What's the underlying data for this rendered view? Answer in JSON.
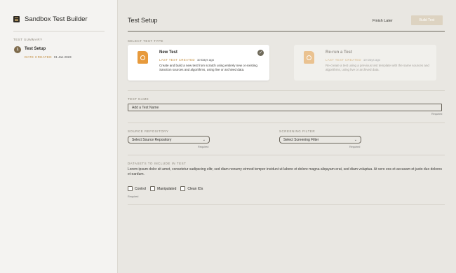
{
  "app": {
    "title": "Sandbox Test Builder",
    "logo_icon": "grid-logo-icon"
  },
  "sidebar": {
    "section_label": "TEST SUMMARY",
    "step": {
      "number": "1",
      "title": "Test Setup",
      "date_label": "DATE CREATED",
      "date_value": "01 Jan 2023"
    }
  },
  "header": {
    "title": "Test Setup",
    "finish_later": "Finish Later",
    "build_test": "Build Test"
  },
  "select_type": {
    "label": "SELECT TEST TYPE",
    "new_test": {
      "title": "New Test",
      "meta_label": "LAST TEST CREATED",
      "meta_value": "10 Days ago",
      "description": "Create and build a new test from scratch using entirely new or existing Sanction sources and algorithms, using live or archived data."
    },
    "rerun_test": {
      "title": "Re-run a Test",
      "meta_label": "LAST TEST CREATED",
      "meta_value": "10 Days ago",
      "description": "Re-create a test using a previous test template with the same sources and algorithms, using live or archived data."
    }
  },
  "test_name": {
    "label": "TEST NAME",
    "placeholder": "Add a Test Name",
    "required": "Required"
  },
  "source_repository": {
    "label": "SOURCE REPOSITORY",
    "value": "Select Source Repository",
    "required": "Required"
  },
  "screening_filter": {
    "label": "SCREENING FILTER",
    "value": "Select Screening Filter",
    "required": "Required"
  },
  "datasets": {
    "label": "DATASETS TO INCLUDE IN TEST",
    "description": "Lorem ipsum dolor sit amet, consetetur sadipscing elitr, sed diam nonumy eirmod tempor invidunt ut labore et dolore magna aliquyam erat, sed diam voluptua. At vero eos et accusam et justo duo dolores et eardum.",
    "options": [
      "Control",
      "Manipulated",
      "Clean IDs"
    ],
    "required": "Required"
  },
  "colors": {
    "accent": "#7d6a4b",
    "label_orange": "#c08a3a",
    "icon_orange": "#e79a3c",
    "background": "#e9e7e2"
  }
}
